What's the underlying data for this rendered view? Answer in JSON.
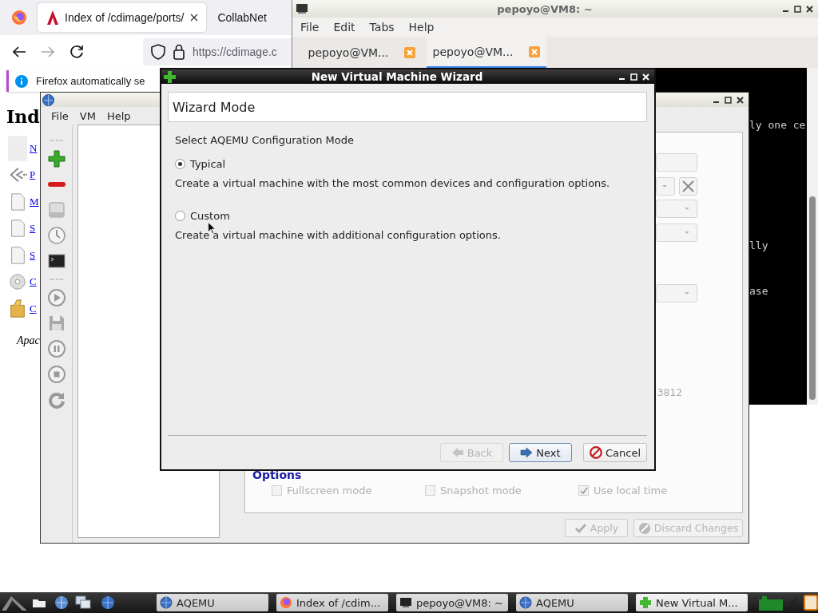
{
  "firefox": {
    "tabs": [
      {
        "label": "Index of /cdimage/ports/",
        "selected": true
      },
      {
        "label": "CollabNet",
        "selected": false
      }
    ],
    "url": "https://cdimage.c",
    "notification": "Firefox automatically se",
    "page": {
      "heading": "Ind",
      "links": [
        "N",
        "P",
        "M",
        "S",
        "S",
        "C",
        "C"
      ],
      "footer": "Apac"
    }
  },
  "terminal": {
    "title": "pepoyo@VM8: ~",
    "menu": [
      "File",
      "Edit",
      "Tabs",
      "Help"
    ],
    "tabs": [
      {
        "label": "pepoyo@VM...",
        "selected": false
      },
      {
        "label": "pepoyo@VM...",
        "selected": true
      }
    ],
    "lines": [
      "ly one ce",
      "lly",
      "ase"
    ]
  },
  "aqemu": {
    "menu": [
      "File",
      "VM",
      "Help"
    ],
    "port_text": "3812",
    "options": {
      "title": "Options",
      "items": [
        {
          "label": "Fullscreen mode",
          "checked": false,
          "disabled": true
        },
        {
          "label": "Snapshot mode",
          "checked": false,
          "disabled": true
        },
        {
          "label": "Use local time",
          "checked": true,
          "disabled": true
        }
      ]
    },
    "buttons": [
      {
        "label": "Apply",
        "kind": "apply",
        "disabled": true
      },
      {
        "label": "Discard Changes",
        "kind": "discard",
        "disabled": true
      }
    ]
  },
  "wizard": {
    "title": "New Virtual Machine Wizard",
    "header": "Wizard Mode",
    "prompt": "Select AQEMU Configuration Mode",
    "modes": [
      {
        "label": "Typical",
        "selected": true,
        "description": "Create a virtual machine with the most common devices and configuration options."
      },
      {
        "label": "Custom",
        "selected": false,
        "description": "Create a virtual machine with additional configuration options."
      }
    ],
    "buttons": [
      {
        "label": "Back",
        "kind": "back",
        "disabled": true
      },
      {
        "label": "Next",
        "kind": "next",
        "disabled": false
      },
      {
        "label": "Cancel",
        "kind": "cancel",
        "disabled": false
      }
    ]
  },
  "taskbar": {
    "tasks": [
      {
        "label": "AQEMU",
        "kind": "aqemu",
        "selected": false
      },
      {
        "label": "Index of /cdim...",
        "kind": "browser",
        "selected": false
      },
      {
        "label": "pepoyo@VM8: ~",
        "kind": "terminal",
        "selected": false
      },
      {
        "label": "AQEMU",
        "kind": "aqemu",
        "selected": false
      },
      {
        "label": "New Virtual M...",
        "kind": "wizard",
        "selected": true
      }
    ]
  }
}
